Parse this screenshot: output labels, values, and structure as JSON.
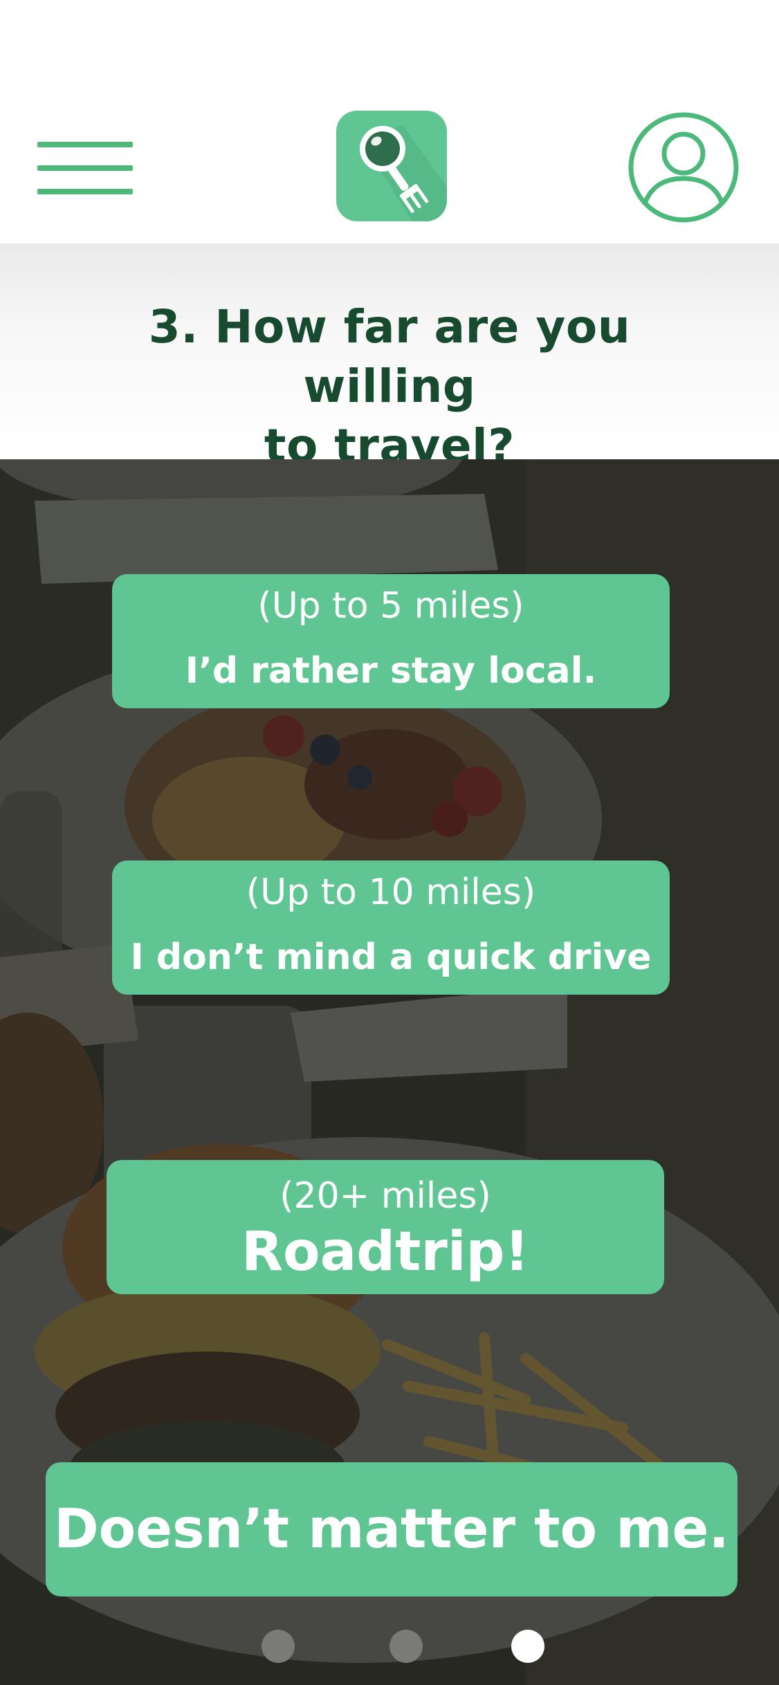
{
  "header": {
    "menu_icon": "hamburger-menu-icon",
    "logo_icon": "magnifier-fork-logo",
    "profile_icon": "user-profile-icon"
  },
  "question": {
    "line1": "3. How far are you willing",
    "line2": "to travel?"
  },
  "options": [
    {
      "range": "(Up to 5 miles)",
      "label": "I’d rather stay local."
    },
    {
      "range": "(Up to 10 miles)",
      "label": "I don’t mind a quick drive"
    },
    {
      "range": "(20+ miles)",
      "label": "Roadtrip!"
    },
    {
      "label": "Doesn’t matter to me."
    }
  ],
  "pagination": {
    "total": 3,
    "current": 3
  },
  "colors": {
    "accent": "#5ec593",
    "heading": "#174a2f",
    "dot_inactive": "#7a7a76",
    "dot_active": "#ffffff"
  }
}
